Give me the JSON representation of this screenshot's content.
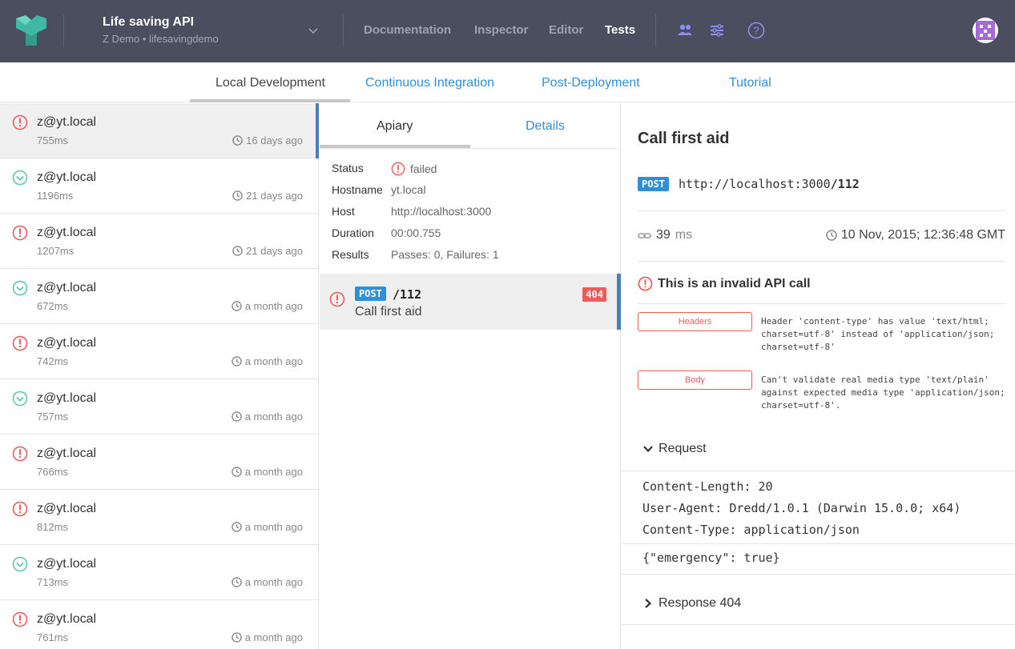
{
  "header": {
    "project_title": "Life saving API",
    "project_subtitle": "Z Demo • lifesavingdemo",
    "nav": [
      "Documentation",
      "Inspector",
      "Editor",
      "Tests"
    ],
    "active_nav": "Tests",
    "icons": [
      "users-icon",
      "sliders-icon",
      "help-icon"
    ]
  },
  "subtabs": {
    "items": [
      "Local Development",
      "Continuous Integration",
      "Post-Deployment",
      "Tutorial"
    ],
    "active": "Local Development"
  },
  "runs": [
    {
      "status": "failed",
      "name": "z@yt.local",
      "duration": "755ms",
      "when": "16 days ago"
    },
    {
      "status": "passed",
      "name": "z@yt.local",
      "duration": "1196ms",
      "when": "21 days ago"
    },
    {
      "status": "failed",
      "name": "z@yt.local",
      "duration": "1207ms",
      "when": "21 days ago"
    },
    {
      "status": "passed",
      "name": "z@yt.local",
      "duration": "672ms",
      "when": "a month ago"
    },
    {
      "status": "failed",
      "name": "z@yt.local",
      "duration": "742ms",
      "when": "a month ago"
    },
    {
      "status": "passed",
      "name": "z@yt.local",
      "duration": "757ms",
      "when": "a month ago"
    },
    {
      "status": "failed",
      "name": "z@yt.local",
      "duration": "766ms",
      "when": "a month ago"
    },
    {
      "status": "failed",
      "name": "z@yt.local",
      "duration": "812ms",
      "when": "a month ago"
    },
    {
      "status": "passed",
      "name": "z@yt.local",
      "duration": "713ms",
      "when": "a month ago"
    },
    {
      "status": "failed",
      "name": "z@yt.local",
      "duration": "761ms",
      "when": "a month ago"
    }
  ],
  "middle": {
    "tabs": [
      "Apiary",
      "Details"
    ],
    "active_tab": "Apiary",
    "details": [
      {
        "key": "Status",
        "value": "failed"
      },
      {
        "key": "Hostname",
        "value": "yt.local"
      },
      {
        "key": "Host",
        "value": "http://localhost:3000"
      },
      {
        "key": "Duration",
        "value": "00:00.755"
      },
      {
        "key": "Results",
        "value": "Passes: 0, Failures: 1"
      }
    ],
    "transaction": {
      "method": "POST",
      "path": "/112",
      "name": "Call first aid",
      "status_code": "404"
    }
  },
  "detail": {
    "title": "Call first aid",
    "method": "POST",
    "url_base": "http://localhost:3000",
    "url_path": "/112",
    "duration_value": "39",
    "duration_unit": "ms",
    "date": "10 Nov, 2015; 12:36:48 GMT",
    "error_title": "This is an invalid API call",
    "errors": [
      {
        "tag": "Headers",
        "message": "Header 'content-type' has value 'text/html; charset=utf-8' instead of 'application/json; charset=utf-8'"
      },
      {
        "tag": "Body",
        "message": "Can't validate real media type 'text/plain' against expected media type 'application/json; charset=utf-8'."
      }
    ],
    "request_label": "Request",
    "request_headers": [
      "Content-Length: 20",
      "User-Agent: Dredd/1.0.1 (Darwin 15.0.0; x64)",
      "Content-Type: application/json"
    ],
    "request_body": "{\"emergency\": true}",
    "response_label": "Response 404"
  },
  "colors": {
    "header_bg": "#4a4e5e",
    "link_blue": "#2f8fd8",
    "fail_red": "#ef5b5b",
    "pass_green": "#5cc9a8",
    "selection_blue": "#4a7fb8"
  }
}
